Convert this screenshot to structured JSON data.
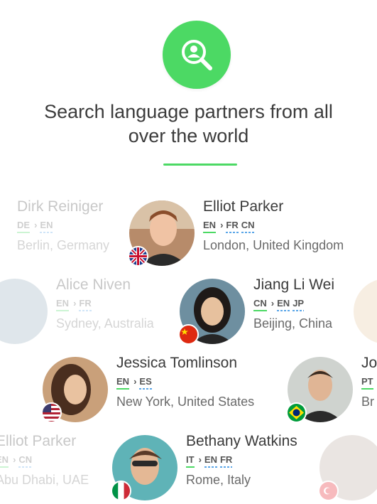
{
  "hero": {
    "icon": "search-user-icon",
    "title": "Search language partners from all over the world",
    "accent": "#4cd964"
  },
  "rows": [
    [
      {
        "name": "Dirk Reiniger",
        "native": [
          "DE"
        ],
        "learning": [
          "EN"
        ],
        "location": "Berlin, Germany",
        "flag": "de-flag-icon",
        "faded": true
      },
      {
        "name": "Elliot Parker",
        "native": [
          "EN"
        ],
        "learning": [
          "FR",
          "CN"
        ],
        "location": "London, United Kingdom",
        "flag": "uk-flag-icon",
        "faded": false
      }
    ],
    [
      {
        "name": "Alice Niven",
        "native": [
          "EN"
        ],
        "learning": [
          "FR"
        ],
        "location": "Sydney, Australia",
        "flag": "au-flag-icon",
        "faded": true
      },
      {
        "name": "Jiang Li Wei",
        "native": [
          "CN"
        ],
        "learning": [
          "EN",
          "JP"
        ],
        "location": "Beijing, China",
        "flag": "cn-flag-icon",
        "faded": false
      }
    ],
    [
      {
        "name": "Jessica Tomlinson",
        "native": [
          "EN"
        ],
        "learning": [
          "ES"
        ],
        "location": "New York, United States",
        "flag": "us-flag-icon",
        "faded": false
      },
      {
        "name": "Jo",
        "native": [
          "PT"
        ],
        "learning": [],
        "location": "Br",
        "flag": "br-flag-icon",
        "faded": false
      }
    ],
    [
      {
        "name": "Elliot Parker",
        "native": [
          "EN"
        ],
        "learning": [
          "CN"
        ],
        "location": "Abu Dhabi, UAE",
        "flag": "ae-flag-icon",
        "faded": true
      },
      {
        "name": "Bethany Watkins",
        "native": [
          "IT"
        ],
        "learning": [
          "EN",
          "FR"
        ],
        "location": "Rome, Italy",
        "flag": "it-flag-icon",
        "faded": false
      }
    ]
  ]
}
